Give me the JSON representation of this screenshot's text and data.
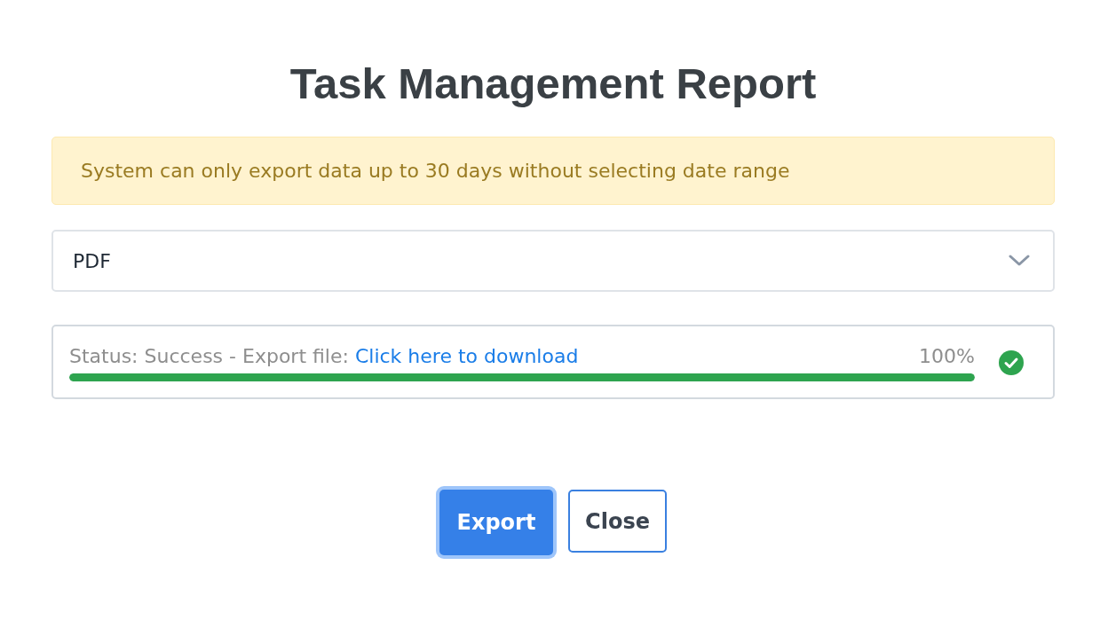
{
  "title": "Task Management Report",
  "alert": {
    "text": "System can only export data up to 30 days without selecting date range"
  },
  "format_select": {
    "value": "PDF"
  },
  "export_status": {
    "label": "Status: Success - Export file:",
    "link": "Click here to download",
    "percent": "100%",
    "level": 1,
    "kind": "success"
  },
  "buttons": [
    {
      "label": "Export",
      "kind": "primary",
      "focused": true
    },
    {
      "label": "Close",
      "kind": "outline",
      "focused": false
    }
  ]
}
